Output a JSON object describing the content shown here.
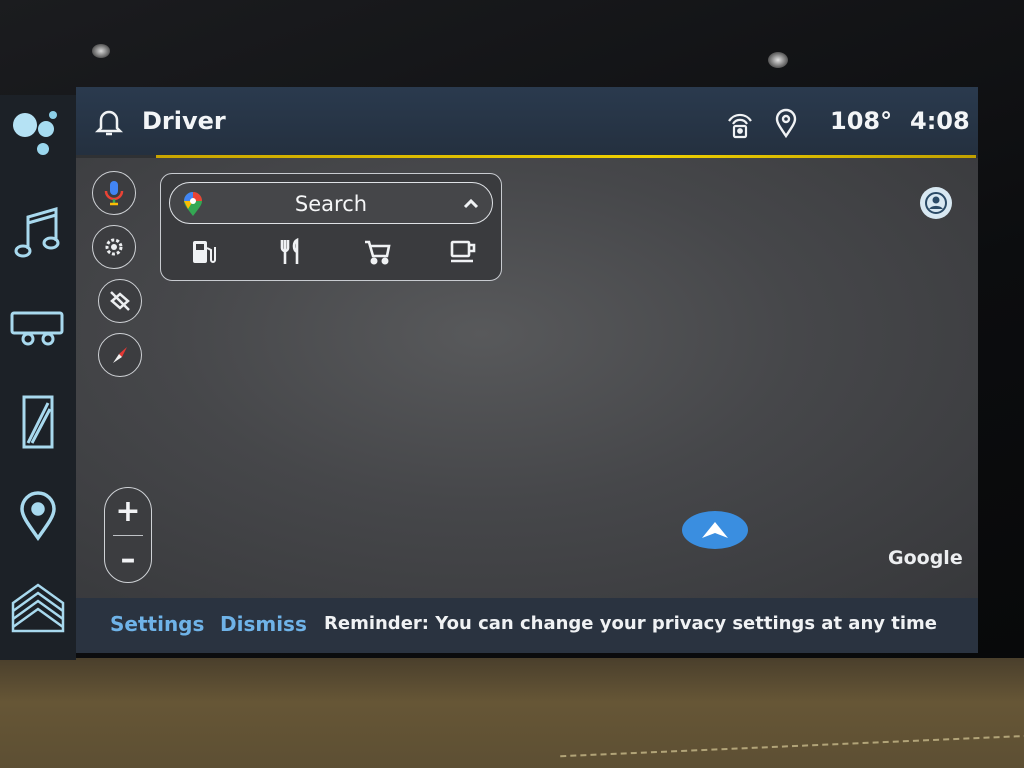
{
  "status": {
    "profile": "Driver",
    "temperature": "108°",
    "time": "4:08"
  },
  "rail": {
    "items": [
      {
        "icon": "assistant-icon"
      },
      {
        "icon": "music-icon"
      },
      {
        "icon": "vehicle-icon"
      },
      {
        "icon": "mirror-icon"
      },
      {
        "icon": "location-pin-icon"
      },
      {
        "icon": "home-icon"
      }
    ]
  },
  "map_controls": {
    "buttons": [
      "microphone-icon",
      "settings-icon",
      "layers-off-icon",
      "compass-icon"
    ]
  },
  "search": {
    "label": "Search",
    "categories": [
      "gas-station-icon",
      "restaurant-icon",
      "shopping-cart-icon",
      "coffee-icon"
    ]
  },
  "zoom": {
    "plus": "+",
    "minus": "–"
  },
  "watermark": "Google",
  "bottom_bar": {
    "settings_label": "Settings",
    "dismiss_label": "Dismiss",
    "reminder": "Reminder: You can change your privacy settings at any time"
  },
  "colors": {
    "accent_link": "#6fb3e8",
    "status_accent": "#f0d000",
    "position_marker": "#3a8ee0",
    "rail_icon": "#9fd3ea"
  }
}
